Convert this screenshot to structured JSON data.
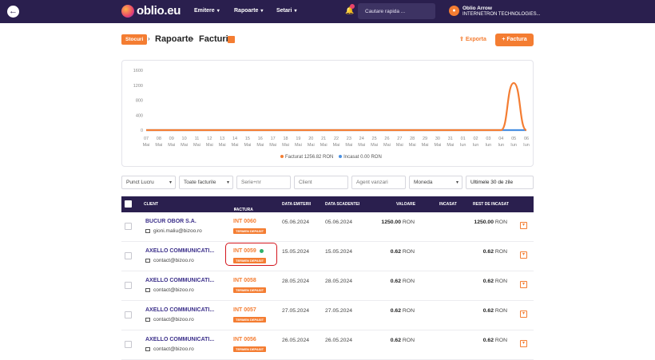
{
  "nav": {
    "logo": "oblio.eu",
    "menu": [
      "Emitere",
      "Rapoarte",
      "Setari"
    ],
    "search_placeholder": "Cautare rapida ...",
    "user_name": "Oblio Arrow",
    "user_company": "INTERNETRON TECHNOLOGIES..."
  },
  "breadcrumb": {
    "badge": "Stocuri",
    "items": [
      "Rapoarte",
      "Facturi"
    ]
  },
  "actions": {
    "export": "Exporta",
    "new_invoice": "+ Factura"
  },
  "chart_data": {
    "type": "line",
    "x": [
      "07 Mai",
      "08 Mai",
      "09 Mai",
      "10 Mai",
      "11 Mai",
      "12 Mai",
      "13 Mai",
      "14 Mai",
      "15 Mai",
      "16 Mai",
      "17 Mai",
      "18 Mai",
      "19 Mai",
      "20 Mai",
      "21 Mai",
      "22 Mai",
      "23 Mai",
      "24 Mai",
      "25 Mai",
      "26 Mai",
      "27 Mai",
      "28 Mai",
      "29 Mai",
      "30 Mai",
      "31 Mai",
      "01 Iun",
      "02 Iun",
      "03 Iun",
      "04 Iun",
      "05 Iun",
      "06 Iun"
    ],
    "x_day": [
      "07",
      "08",
      "09",
      "10",
      "11",
      "12",
      "13",
      "14",
      "15",
      "16",
      "17",
      "18",
      "19",
      "20",
      "21",
      "22",
      "23",
      "24",
      "25",
      "26",
      "27",
      "28",
      "29",
      "30",
      "31",
      "01",
      "02",
      "03",
      "04",
      "05",
      "06"
    ],
    "x_month": [
      "Mai",
      "Mai",
      "Mai",
      "Mai",
      "Mai",
      "Mai",
      "Mai",
      "Mai",
      "Mai",
      "Mai",
      "Mai",
      "Mai",
      "Mai",
      "Mai",
      "Mai",
      "Mai",
      "Mai",
      "Mai",
      "Mai",
      "Mai",
      "Mai",
      "Mai",
      "Mai",
      "Mai",
      "Mai",
      "Iun",
      "Iun",
      "Iun",
      "Iun",
      "Iun",
      "Iun"
    ],
    "yticks": [
      "1600",
      "1200",
      "800",
      "400",
      "0"
    ],
    "ylim": [
      0,
      1600
    ],
    "series": [
      {
        "name": "Facturat",
        "color": "#f47d32",
        "values": [
          0,
          0,
          0,
          0,
          0,
          0,
          0,
          0,
          0,
          0,
          0,
          0,
          0,
          0,
          0,
          0,
          0,
          0,
          0,
          0,
          0,
          0,
          0,
          0,
          0,
          0,
          0,
          0,
          0,
          1256.82,
          0
        ]
      },
      {
        "name": "Incasat",
        "color": "#4a90e2",
        "values": [
          0,
          0,
          0,
          0,
          0,
          0,
          0,
          0,
          0,
          0,
          0,
          0,
          0,
          0,
          0,
          0,
          0,
          0,
          0,
          0,
          0,
          0,
          0,
          0,
          0,
          0,
          0,
          0,
          0,
          0,
          0
        ]
      }
    ],
    "legend": [
      {
        "label": "Facturat",
        "value": "1256.82 RON"
      },
      {
        "label": "Incasat",
        "value": "0.00 RON"
      }
    ]
  },
  "filters": {
    "punct_lucru": "Punct Lucru",
    "toate_facturile": "Toate facturile",
    "serie_nr": "Serie+nr",
    "client": "Client",
    "agent": "Agent vanzari",
    "moneda": "Moneda",
    "perioada": "Ultimele 30 de zile"
  },
  "table": {
    "headers": [
      "CLIENT",
      "FACTURA",
      "DATA EMITERII",
      "DATA SCADENTEI",
      "VALOARE",
      "INCASAT",
      "REST DE INCASAT"
    ],
    "rows": [
      {
        "client": "BUCUR OBOR S.A.",
        "email": "gioni.maliu@bizoo.ro",
        "invoice": "INT 0060",
        "badge": "TERMEN DEPASIT",
        "issued": "05.06.2024",
        "due": "05.06.2024",
        "value": "1250.00",
        "rest": "1250.00",
        "currency": "RON"
      },
      {
        "client": "AXELLO COMMUNICATI...",
        "email": "contact@bizoo.ro",
        "invoice": "INT 0059",
        "badge": "TERMEN DEPASIT",
        "issued": "15.05.2024",
        "due": "15.05.2024",
        "value": "0.62",
        "rest": "0.62",
        "currency": "RON"
      },
      {
        "client": "AXELLO COMMUNICATI...",
        "email": "contact@bizoo.ro",
        "invoice": "INT 0058",
        "badge": "TERMEN DEPASIT",
        "issued": "28.05.2024",
        "due": "28.05.2024",
        "value": "0.62",
        "rest": "0.62",
        "currency": "RON"
      },
      {
        "client": "AXELLO COMMUNICATI...",
        "email": "contact@bizoo.ro",
        "invoice": "INT 0057",
        "badge": "TERMEN DEPASIT",
        "issued": "27.05.2024",
        "due": "27.05.2024",
        "value": "0.62",
        "rest": "0.62",
        "currency": "RON"
      },
      {
        "client": "AXELLO COMMUNICATI...",
        "email": "contact@bizoo.ro",
        "invoice": "INT 0056",
        "badge": "TERMEN DEPASIT",
        "issued": "26.05.2024",
        "due": "26.05.2024",
        "value": "0.62",
        "rest": "0.62",
        "currency": "RON"
      }
    ]
  }
}
